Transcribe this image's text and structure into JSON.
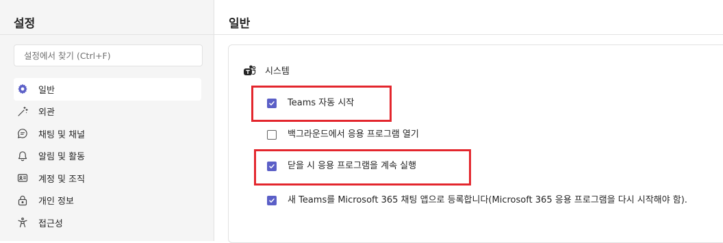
{
  "sidebar": {
    "title": "설정",
    "search_placeholder": "설정에서 찾기 (Ctrl+F)",
    "items": [
      {
        "label": "일반",
        "icon": "gear-icon",
        "active": true
      },
      {
        "label": "외관",
        "icon": "magic-wand-icon",
        "active": false
      },
      {
        "label": "채팅 및 채널",
        "icon": "chat-icon",
        "active": false
      },
      {
        "label": "알림 및 활동",
        "icon": "bell-icon",
        "active": false
      },
      {
        "label": "계정 및 조직",
        "icon": "id-card-icon",
        "active": false
      },
      {
        "label": "개인 정보",
        "icon": "lock-icon",
        "active": false
      },
      {
        "label": "접근성",
        "icon": "accessibility-icon",
        "active": false
      }
    ]
  },
  "main": {
    "title": "일반",
    "section": {
      "label": "시스템",
      "icon": "teams-icon"
    },
    "options": [
      {
        "label": "Teams 자동 시작",
        "checked": true
      },
      {
        "label": "백그라운드에서 응용 프로그램 열기",
        "checked": false
      },
      {
        "label": "닫을 시 응용 프로그램을 계속 실행",
        "checked": true
      },
      {
        "label": "새 Teams를 Microsoft 365 채팅 앱으로 등록합니다(Microsoft 365 응용 프로그램을 다시 시작해야 함).",
        "checked": true
      }
    ]
  },
  "colors": {
    "accent": "#5b5fc7",
    "highlight": "#e3262d"
  }
}
